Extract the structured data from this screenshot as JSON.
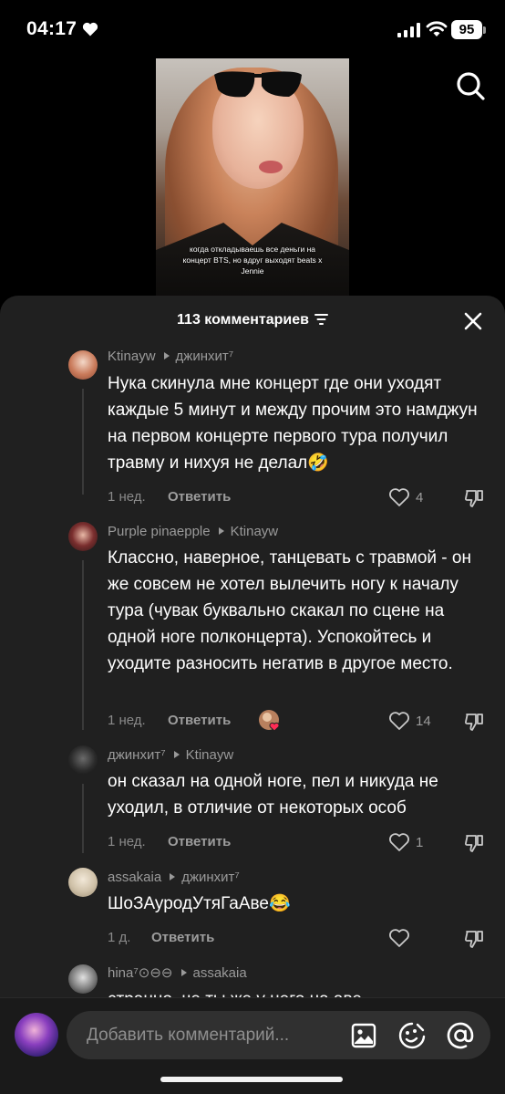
{
  "status_bar": {
    "time": "04:17",
    "battery": "95"
  },
  "video": {
    "caption": "когда откладываешь все деньги на концерт BTS, но вдруг выходят beats x Jennie"
  },
  "sheet": {
    "title": "113 комментариев"
  },
  "comments": [
    {
      "author": "Ktinayw",
      "reply_to": "джинхит⁷",
      "text": "Нука скинула мне концерт где они уходят каждые 5 минут и между прочим это намджун на первом концерте первого тура получил травму и нихуя не делал🤣",
      "time": "1 нед.",
      "reply_label": "Ответить",
      "likes": "4"
    },
    {
      "author": "Purple pinaepple",
      "reply_to": "Ktinayw",
      "text": "Классно, наверное, танцевать с травмой - он же совсем не хотел вылечить ногу к началу тура (чувак буквально скакал по сцене на одной ноге полконцерта). Успокойтесь и уходите разносить негатив в другое место.",
      "time": "1 нед.",
      "reply_label": "Ответить",
      "likes": "14"
    },
    {
      "author": "джинхит⁷",
      "reply_to": "Ktinayw",
      "text": "он сказал на одной ноге, пел и никуда не уходил, в отличие от некоторых особ",
      "time": "1 нед.",
      "reply_label": "Ответить",
      "likes": "1"
    },
    {
      "author": "assakaia",
      "reply_to": "джинхит⁷",
      "text": "ШоЗАуродУтяГаАве😂",
      "time": "1 д.",
      "reply_label": "Ответить",
      "likes": ""
    },
    {
      "author": "hina⁷⊙⊖⊖",
      "reply_to": "assakaia",
      "text": "странно, че ты же у него на аве"
    }
  ],
  "input": {
    "placeholder": "Добавить комментарий..."
  },
  "colors": {
    "sheet_bg": "#202020",
    "text_secondary": "#9a9a9a",
    "input_bg": "#303030"
  },
  "icons": [
    "heart-icon",
    "signal-icon",
    "wifi-icon",
    "search-icon",
    "filter-icon",
    "close-icon",
    "like-heart-icon",
    "dislike-icon",
    "image-icon",
    "emoji-icon",
    "mention-icon"
  ]
}
